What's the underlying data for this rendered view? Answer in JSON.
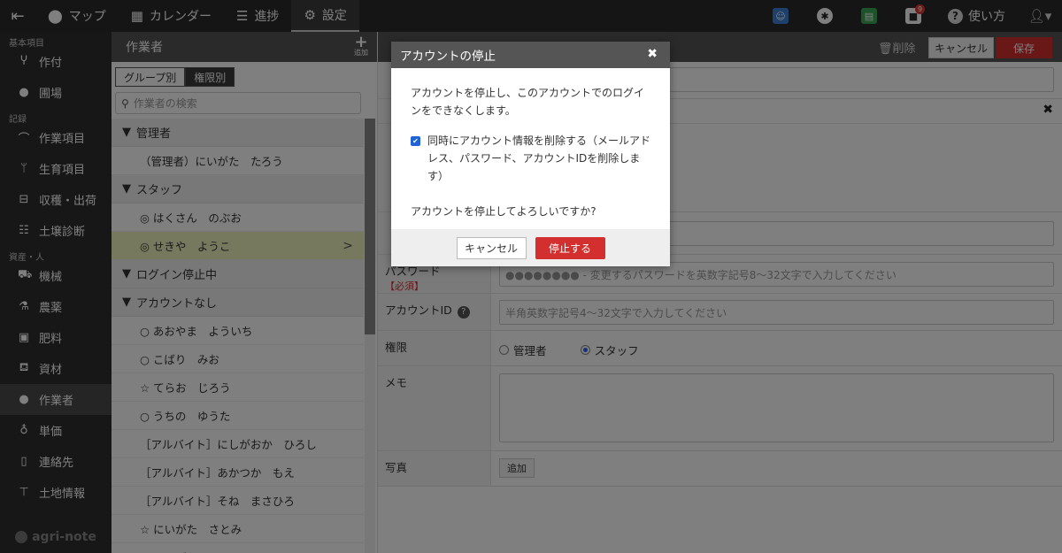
{
  "topnav": {
    "items": [
      {
        "label": "マップ",
        "icon": "map-pin-icon"
      },
      {
        "label": "カレンダー",
        "icon": "calendar-icon"
      },
      {
        "label": "進捗",
        "icon": "checklist-icon"
      },
      {
        "label": "設定",
        "icon": "gear-icon"
      }
    ],
    "notification_count": "9",
    "help_label": "使い方"
  },
  "sidebar": {
    "sections": [
      {
        "title": "基本項目",
        "items": [
          {
            "label": "作付"
          },
          {
            "label": "圃場"
          }
        ]
      },
      {
        "title": "記録",
        "items": [
          {
            "label": "作業項目"
          },
          {
            "label": "生育項目"
          },
          {
            "label": "収穫・出荷"
          },
          {
            "label": "土壌診断"
          }
        ]
      },
      {
        "title": "資産・人",
        "items": [
          {
            "label": "機械"
          },
          {
            "label": "農薬"
          },
          {
            "label": "肥料"
          },
          {
            "label": "資材"
          },
          {
            "label": "作業者"
          },
          {
            "label": "単価"
          },
          {
            "label": "連絡先"
          },
          {
            "label": "土地情報"
          }
        ]
      }
    ],
    "logo": "agri-note"
  },
  "mid": {
    "title": "作業者",
    "add_label": "追加",
    "toggle": [
      "グループ別",
      "権限別"
    ],
    "search_placeholder": "作業者の検索",
    "groups": [
      {
        "title": "管理者",
        "rows": [
          "（管理者）にいがた　たろう"
        ]
      },
      {
        "title": "スタッフ",
        "rows": [
          "◎ はくさん　のぶお",
          "◎ せきや　ようこ"
        ]
      },
      {
        "title": "ログイン停止中",
        "rows": []
      },
      {
        "title": "アカウントなし",
        "rows": [
          "○ あおやま　よういち",
          "○ こばり　みお",
          "☆ てらお　じろう",
          "○ うちの　ゆうた",
          "［アルバイト］にしがおか　ひろし",
          "［アルバイト］あかつか　もえ",
          "［アルバイト］そね　まさひろ",
          "☆ にいがた　さとみ",
          "☆ にいがた　いちろう"
        ]
      }
    ]
  },
  "right": {
    "delete_label": "削除",
    "cancel_label": "キャンセル",
    "save_label": "保存",
    "password_label": "パスワード",
    "required_label": "【必須】",
    "password_placeholder": "●●●●●●●● - 変更するパスワードを英数字記号8～32文字で入力してください",
    "account_id_label": "アカウントID",
    "account_id_placeholder": "半角英数字記号4～32文字で入力してください",
    "role_label": "権限",
    "role_admin": "管理者",
    "role_staff": "スタッフ",
    "memo_label": "メモ",
    "photo_label": "写真",
    "photo_add": "追加"
  },
  "modal": {
    "title": "アカウントの停止",
    "message": "アカウントを停止し、このアカウントでのログインをできなくします。",
    "checkbox_label": "同時にアカウント情報を削除する（メールアドレス、パスワード、アカウントIDを削除します）",
    "checkbox_checked": true,
    "confirm_text": "アカウントを停止してよろしいですか?",
    "cancel_label": "キャンセル",
    "stop_label": "停止する"
  }
}
